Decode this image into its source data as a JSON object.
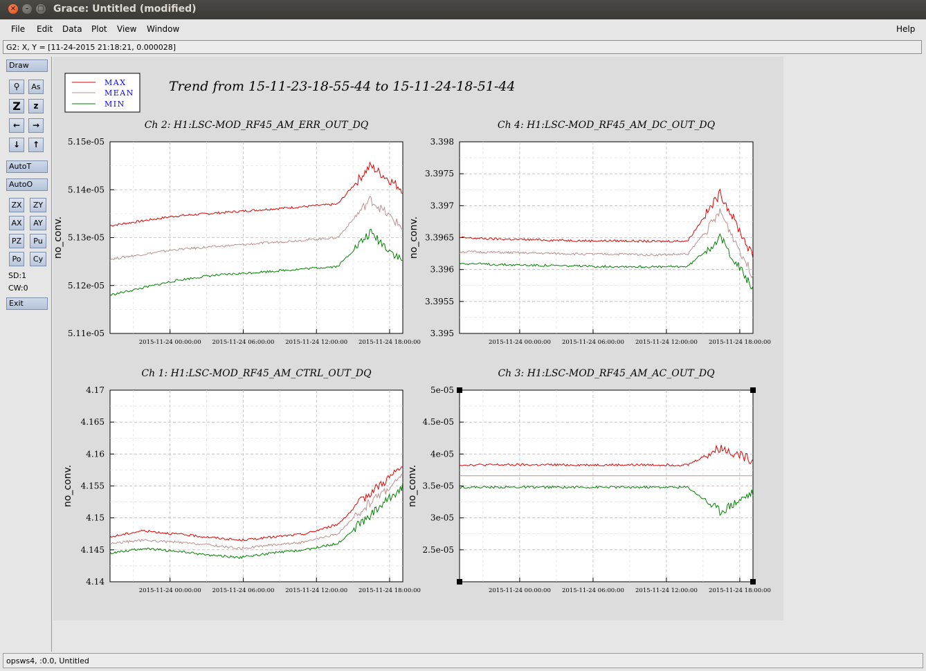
{
  "window": {
    "title": "Grace: Untitled (modified)"
  },
  "menu": {
    "file": "File",
    "edit": "Edit",
    "data": "Data",
    "plot": "Plot",
    "view": "View",
    "window": "Window",
    "help": "Help"
  },
  "locator": "G2: X, Y = [11-24-2015 21:18:21, 0.000028]",
  "toolbar": {
    "draw": "Draw",
    "autot": "AutoT",
    "autoo": "AutoO",
    "exit": "Exit",
    "zx": "ZX",
    "zy": "ZY",
    "ax": "AX",
    "ay": "AY",
    "pz": "PZ",
    "pu": "Pu",
    "po": "Po",
    "cy": "Cy",
    "sd": "SD:1",
    "cw": "CW:0"
  },
  "status": "opsws4, :0.0, Untitled",
  "plot_title": "Trend from 15-11-23-18-55-44 to 15-11-24-18-51-44",
  "legend": [
    "MAX",
    "MEAN",
    "MIN"
  ],
  "colors": {
    "max": "#e00000",
    "mean": "#bc8f8f",
    "min": "#008000",
    "legend_text": "#0000ff"
  },
  "chart_data": [
    {
      "type": "line",
      "title": "Ch 2: H1:LSC-MOD_RF45_AM_ERR_OUT_DQ",
      "ylabel": "no_conv.",
      "yticks": [
        "5.15e-05",
        "5.14e-05",
        "5.13e-05",
        "5.12e-05",
        "5.11e-05"
      ],
      "ylim": [
        5.11e-05,
        5.15e-05
      ],
      "xticks": [
        "2015-11-24 00:00:00",
        "2015-11-24 06:00:00",
        "2015-11-24 12:00:00",
        "2015-11-24 18:00:00"
      ],
      "series": [
        {
          "name": "MAX",
          "values": [
            5.1325e-05,
            5.1335e-05,
            5.1345e-05,
            5.135e-05,
            5.1355e-05,
            5.136e-05,
            5.1365e-05,
            5.137e-05,
            5.145e-05,
            5.14e-05
          ]
        },
        {
          "name": "MEAN",
          "values": [
            5.1255e-05,
            5.1265e-05,
            5.1275e-05,
            5.128e-05,
            5.1285e-05,
            5.129e-05,
            5.1295e-05,
            5.13e-05,
            5.138e-05,
            5.132e-05
          ]
        },
        {
          "name": "MIN",
          "values": [
            5.118e-05,
            5.1195e-05,
            5.121e-05,
            5.122e-05,
            5.1225e-05,
            5.123e-05,
            5.1235e-05,
            5.124e-05,
            5.131e-05,
            5.125e-05
          ]
        }
      ]
    },
    {
      "type": "line",
      "title": "Ch 4: H1:LSC-MOD_RF45_AM_DC_OUT_DQ",
      "ylabel": "no_conv.",
      "yticks": [
        "3.398",
        "3.3975",
        "3.397",
        "3.3965",
        "3.396",
        "3.3955",
        "3.395"
      ],
      "ylim": [
        3.395,
        3.398
      ],
      "xticks": [
        "2015-11-24 00:00:00",
        "2015-11-24 06:00:00",
        "2015-11-24 12:00:00",
        "2015-11-24 18:00:00"
      ],
      "series": [
        {
          "name": "MAX",
          "values": [
            3.3965,
            3.39648,
            3.39647,
            3.39646,
            3.39645,
            3.39645,
            3.39644,
            3.39645,
            3.3972,
            3.3962
          ]
        },
        {
          "name": "MEAN",
          "values": [
            3.39628,
            3.39627,
            3.39626,
            3.39625,
            3.39624,
            3.39624,
            3.39623,
            3.39624,
            3.3969,
            3.3959
          ]
        },
        {
          "name": "MIN",
          "values": [
            3.3961,
            3.39608,
            3.39607,
            3.39606,
            3.39605,
            3.39605,
            3.39604,
            3.39605,
            3.3965,
            3.3957
          ]
        }
      ]
    },
    {
      "type": "line",
      "title": "Ch 1: H1:LSC-MOD_RF45_AM_CTRL_OUT_DQ",
      "ylabel": "no_conv.",
      "yticks": [
        "4.17",
        "4.165",
        "4.16",
        "4.155",
        "4.15",
        "4.145",
        "4.14"
      ],
      "ylim": [
        4.14,
        4.17
      ],
      "xticks": [
        "2015-11-24 00:00:00",
        "2015-11-24 06:00:00",
        "2015-11-24 12:00:00",
        "2015-11-24 18:00:00"
      ],
      "series": [
        {
          "name": "MAX",
          "values": [
            4.147,
            4.148,
            4.1475,
            4.147,
            4.1465,
            4.147,
            4.1475,
            4.149,
            4.154,
            4.158
          ]
        },
        {
          "name": "MEAN",
          "values": [
            4.146,
            4.1465,
            4.1462,
            4.1458,
            4.1452,
            4.1458,
            4.1462,
            4.1475,
            4.1525,
            4.1565
          ]
        },
        {
          "name": "MIN",
          "values": [
            4.1445,
            4.1452,
            4.1448,
            4.1442,
            4.1438,
            4.1445,
            4.145,
            4.146,
            4.1505,
            4.155
          ]
        }
      ]
    },
    {
      "type": "line",
      "title": "Ch 3: H1:LSC-MOD_RF45_AM_AC_OUT_DQ",
      "ylabel": "no_conv.",
      "yticks": [
        "5e-05",
        "4.5e-05",
        "4e-05",
        "3.5e-05",
        "3e-05",
        "2.5e-05"
      ],
      "ylim": [
        2e-05,
        5e-05
      ],
      "xticks": [
        "2015-11-24 00:00:00",
        "2015-11-24 06:00:00",
        "2015-11-24 12:00:00",
        "2015-11-24 18:00:00"
      ],
      "series": [
        {
          "name": "MAX",
          "values": [
            3.83e-05,
            3.83e-05,
            3.83e-05,
            3.83e-05,
            3.83e-05,
            3.83e-05,
            3.83e-05,
            3.83e-05,
            4.1e-05,
            3.9e-05
          ]
        },
        {
          "name": "MEAN",
          "values": [
            3.66e-05,
            3.66e-05,
            3.66e-05,
            3.66e-05,
            3.66e-05,
            3.66e-05,
            3.66e-05,
            3.66e-05,
            3.66e-05,
            3.66e-05
          ]
        },
        {
          "name": "MIN",
          "values": [
            3.48e-05,
            3.48e-05,
            3.48e-05,
            3.48e-05,
            3.48e-05,
            3.48e-05,
            3.48e-05,
            3.48e-05,
            3.1e-05,
            3.4e-05
          ]
        }
      ]
    }
  ]
}
